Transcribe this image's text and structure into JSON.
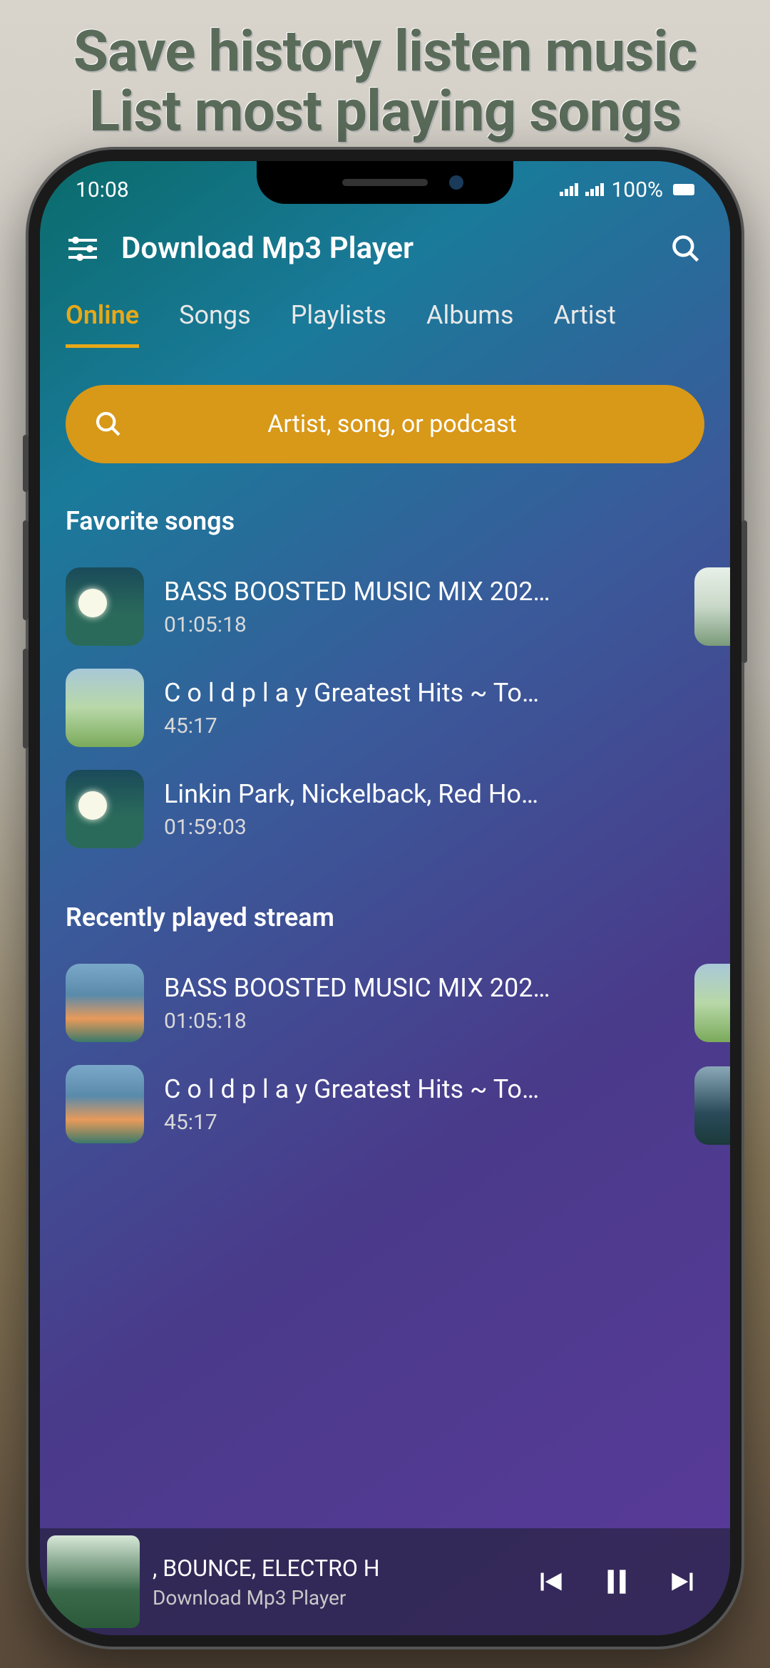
{
  "promo": {
    "line1": "Save history listen music",
    "line2": "List most playing songs"
  },
  "status": {
    "time": "10:08",
    "battery": "100%"
  },
  "header": {
    "title": "Download Mp3 Player"
  },
  "tabs": [
    {
      "label": "Online",
      "active": true
    },
    {
      "label": "Songs",
      "active": false
    },
    {
      "label": "Playlists",
      "active": false
    },
    {
      "label": "Albums",
      "active": false
    },
    {
      "label": "Artist",
      "active": false
    }
  ],
  "search": {
    "placeholder": "Artist, song, or podcast"
  },
  "sections": {
    "favorites": {
      "title": "Favorite songs",
      "items": [
        {
          "title": "BASS BOOSTED MUSIC MIX 202…",
          "duration": "01:05:18"
        },
        {
          "title": "C o l d p l a y Greatest Hits ~ To…",
          "duration": "45:17"
        },
        {
          "title": "Linkin Park, Nickelback, Red Ho…",
          "duration": "01:59:03"
        }
      ]
    },
    "recent": {
      "title": "Recently played stream",
      "items": [
        {
          "title": "BASS BOOSTED MUSIC MIX 202…",
          "duration": "01:05:18"
        },
        {
          "title": "C o l d p l a y Greatest Hits ~ To…",
          "duration": "45:17"
        }
      ]
    }
  },
  "nowPlaying": {
    "title": ", BOUNCE, ELECTRO H",
    "subtitle": "Download Mp3 Player"
  }
}
